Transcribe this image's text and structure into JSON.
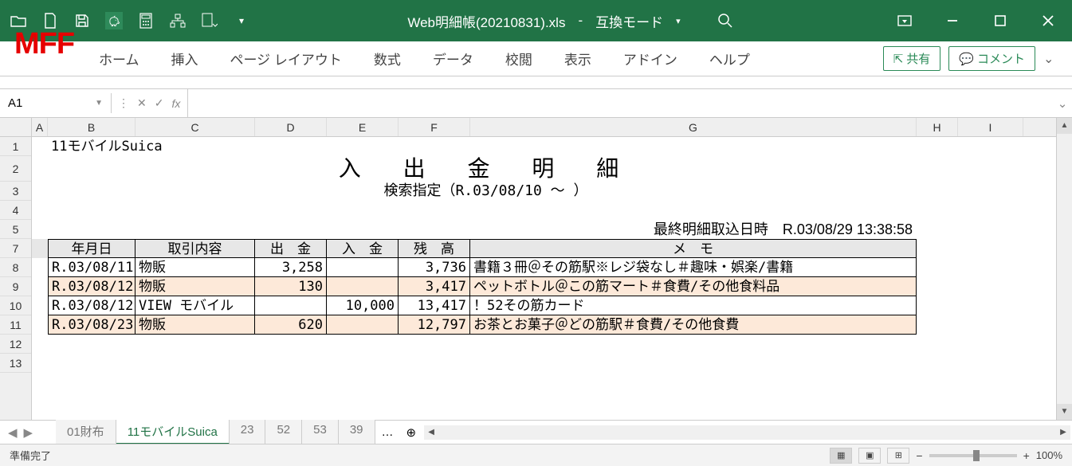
{
  "titlebar": {
    "filename": "Web明細帳(20210831).xls",
    "mode": "互換モード",
    "dropdown": "▾"
  },
  "brand": "MFF",
  "ribbon": {
    "tabs": [
      "ホーム",
      "挿入",
      "ページ レイアウト",
      "数式",
      "データ",
      "校閲",
      "表示",
      "アドイン",
      "ヘルプ"
    ],
    "share": "共有",
    "comment": "コメント"
  },
  "formulaBar": {
    "nameBox": "A1",
    "fx": "fx"
  },
  "columns": [
    "A",
    "B",
    "C",
    "D",
    "E",
    "F",
    "G",
    "H",
    "I"
  ],
  "rowNumbers": [
    "1",
    "2",
    "3",
    "4",
    "5",
    "7",
    "8",
    "9",
    "10",
    "11",
    "12",
    "13"
  ],
  "sheet": {
    "account": "11モバイルSuica",
    "docTitle": "入 出 金 明 細",
    "searchRange": "検索指定（R.03/08/10 ～ ）",
    "lastImportLabel": "最終明細取込日時",
    "lastImportValue": "R.03/08/29 13:38:58",
    "headers": {
      "date": "年月日",
      "desc": "取引内容",
      "out": "出　金",
      "in": "入　金",
      "bal": "残　高",
      "memo": "メ　モ"
    },
    "rows": [
      {
        "date": "R.03/08/11",
        "desc": "物販",
        "out": "3,258",
        "in": "",
        "bal": "3,736",
        "memo": "書籍３冊＠その筋駅※レジ袋なし＃趣味・娯楽/書籍"
      },
      {
        "date": "R.03/08/12",
        "desc": "物販",
        "out": "130",
        "in": "",
        "bal": "3,417",
        "memo": "ペットボトル＠この筋マート＃食費/その他食料品"
      },
      {
        "date": "R.03/08/12",
        "desc": "VIEW モバイル",
        "out": "",
        "in": "10,000",
        "bal": "13,417",
        "memo": "！52その筋カード"
      },
      {
        "date": "R.03/08/23",
        "desc": "物販",
        "out": "620",
        "in": "",
        "bal": "12,797",
        "memo": "お茶とお菓子＠どの筋駅＃食費/その他食費"
      }
    ]
  },
  "sheetTabs": [
    {
      "label": "01財布",
      "active": false
    },
    {
      "label": "11モバイルSuica",
      "active": true
    },
    {
      "label": "23",
      "active": false
    },
    {
      "label": "52",
      "active": false
    },
    {
      "label": "53",
      "active": false
    },
    {
      "label": "39",
      "active": false
    }
  ],
  "sheetMore": "…",
  "statusbar": {
    "ready": "準備完了",
    "zoom": "100%"
  }
}
